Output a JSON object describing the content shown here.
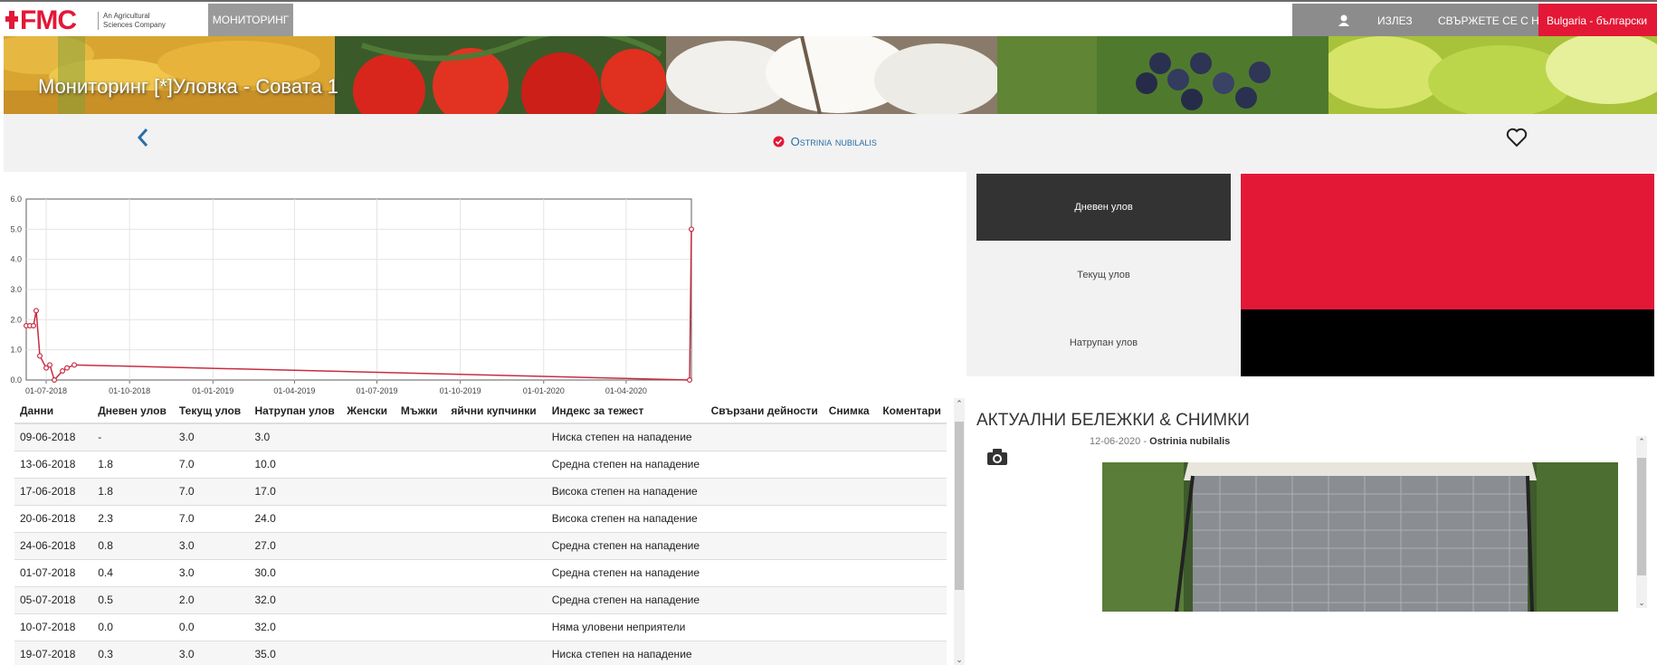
{
  "nav": {
    "logo_text": "FMC",
    "logo_tagline": "An Agricultural Sciences Company",
    "monitoring": "МОНИТОРИНГ",
    "logout": "ИЗЛЕЗ",
    "contact": "СВЪРЖЕТЕ СЕ С НАС",
    "language": "Bulgaria - български"
  },
  "banner": {
    "title": "Мониторинг [*]Уловка - Совата 1"
  },
  "subheader": {
    "pest": "Ostrinia nubilalis"
  },
  "chart_data": {
    "type": "line",
    "x": [
      "2018-06-09",
      "2018-06-13",
      "2018-06-17",
      "2018-06-20",
      "2018-06-24",
      "2018-07-01",
      "2018-07-05",
      "2018-07-10",
      "2018-07-19",
      "2018-07-24",
      "2018-08-01",
      "2020-06-10",
      "2020-06-12"
    ],
    "values": [
      1.8,
      1.8,
      1.8,
      2.3,
      0.8,
      0.4,
      0.5,
      0.0,
      0.3,
      0.4,
      0.5,
      0.0,
      5.0
    ],
    "yticks": [
      "0.0",
      "1.0",
      "2.0",
      "3.0",
      "4.0",
      "5.0",
      "6.0"
    ],
    "xticks": [
      "01-07-2018",
      "01-10-2018",
      "01-01-2019",
      "01-04-2019",
      "01-07-2019",
      "01-10-2019",
      "01-01-2020",
      "01-04-2020"
    ],
    "ylim": [
      0,
      6
    ],
    "grid": true,
    "color": "#c62d42"
  },
  "table": {
    "headers": [
      "Данни",
      "Дневен улов",
      "Текущ улов",
      "Натрупан улов",
      "Женски",
      "Мъжки",
      "яйчни купчинки",
      "Индекс за тежест",
      "Свързани дейности",
      "Снимка",
      "Коментари"
    ],
    "rows": [
      [
        "09-06-2018",
        "-",
        "3.0",
        "3.0",
        "",
        "",
        "",
        "Ниска степен на нападение",
        "",
        "",
        ""
      ],
      [
        "13-06-2018",
        "1.8",
        "7.0",
        "10.0",
        "",
        "",
        "",
        "Средна степен на нападение",
        "",
        "",
        ""
      ],
      [
        "17-06-2018",
        "1.8",
        "7.0",
        "17.0",
        "",
        "",
        "",
        "Висока степен на нападение",
        "",
        "",
        ""
      ],
      [
        "20-06-2018",
        "2.3",
        "7.0",
        "24.0",
        "",
        "",
        "",
        "Висока степен на нападение",
        "",
        "",
        ""
      ],
      [
        "24-06-2018",
        "0.8",
        "3.0",
        "27.0",
        "",
        "",
        "",
        "Средна степен на нападение",
        "",
        "",
        ""
      ],
      [
        "01-07-2018",
        "0.4",
        "3.0",
        "30.0",
        "",
        "",
        "",
        "Средна степен на нападение",
        "",
        "",
        ""
      ],
      [
        "05-07-2018",
        "0.5",
        "2.0",
        "32.0",
        "",
        "",
        "",
        "Средна степен на нападение",
        "",
        "",
        ""
      ],
      [
        "10-07-2018",
        "0.0",
        "0.0",
        "32.0",
        "",
        "",
        "",
        "Няма уловени неприятели",
        "",
        "",
        ""
      ],
      [
        "19-07-2018",
        "0.3",
        "3.0",
        "35.0",
        "",
        "",
        "",
        "Ниска степен на нападение",
        "",
        "",
        ""
      ]
    ]
  },
  "tabs": [
    {
      "label": "Дневен улов",
      "active": true
    },
    {
      "label": "Текущ улов",
      "active": false
    },
    {
      "label": "Натрупан улов",
      "active": false
    }
  ],
  "notes": {
    "title": "АКТУАЛНИ БЕЛЕЖКИ & СНИМКИ",
    "date": "12-06-2020",
    "separator": " - ",
    "pest": "Ostrinia nubilalis"
  },
  "colors": {
    "brand_red": "#e31837",
    "nav_gray": "#8c8c8c",
    "link_blue": "#2a6ea8"
  }
}
